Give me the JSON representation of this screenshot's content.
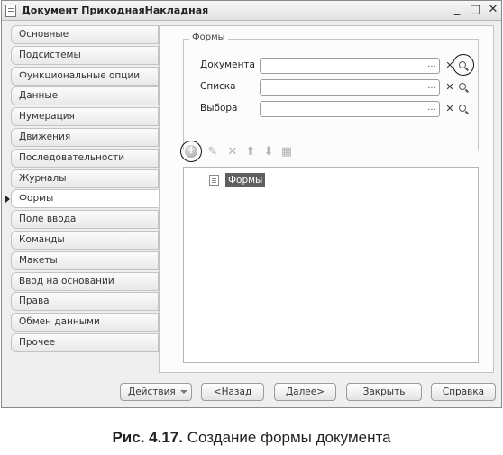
{
  "window": {
    "title": "Документ ПриходнаяНакладная"
  },
  "controls": {
    "minimize": "_",
    "maximize": "□",
    "close": "✕"
  },
  "tabs": [
    {
      "label": "Основные"
    },
    {
      "label": "Подсистемы"
    },
    {
      "label": "Функциональные опции"
    },
    {
      "label": "Данные"
    },
    {
      "label": "Нумерация"
    },
    {
      "label": "Движения"
    },
    {
      "label": "Последовательности"
    },
    {
      "label": "Журналы"
    },
    {
      "label": "Формы",
      "active": true
    },
    {
      "label": "Поле ввода"
    },
    {
      "label": "Команды"
    },
    {
      "label": "Макеты"
    },
    {
      "label": "Ввод на основании"
    },
    {
      "label": "Права"
    },
    {
      "label": "Обмен данными"
    },
    {
      "label": "Прочее"
    }
  ],
  "forms_group": {
    "legend": "Формы",
    "fields": [
      {
        "label": "Документа",
        "value": "",
        "dots": "...",
        "clear": "✕"
      },
      {
        "label": "Списка",
        "value": "",
        "dots": "...",
        "clear": "✕"
      },
      {
        "label": "Выбора",
        "value": "",
        "dots": "...",
        "clear": "✕"
      }
    ]
  },
  "toolbar": {
    "icons": [
      "add-icon",
      "edit-icon",
      "delete-icon",
      "move-up-icon",
      "move-down-icon",
      "properties-icon"
    ],
    "glyphs": {
      "edit": "✎",
      "delete": "✕",
      "up": "⬆",
      "down": "⬇",
      "props": "▦"
    }
  },
  "tree": {
    "items": [
      {
        "label": "Формы",
        "selected": true
      }
    ]
  },
  "buttons": {
    "actions": "Действия",
    "back": "<Назад",
    "next": "Далее>",
    "close": "Закрыть",
    "help": "Справка"
  },
  "caption": {
    "number": "Рис. 4.17.",
    "text": "Создание формы документа"
  }
}
